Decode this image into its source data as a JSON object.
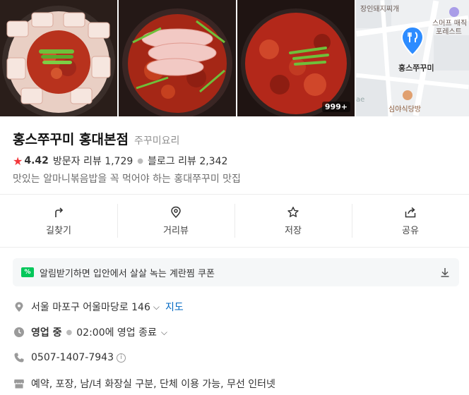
{
  "photos": {
    "count_badge": "999+"
  },
  "map": {
    "labels": {
      "top_left": "장인돼지찌개",
      "top_right_1": "스머프 매직",
      "top_right_2": "포레스트",
      "pin": "홍스쭈꾸미",
      "bottom": "심야식당방",
      "edge": "ae"
    }
  },
  "place": {
    "name": "홍스쭈꾸미 홍대본점",
    "category": "주꾸미요리",
    "rating": "4.42",
    "visitor_reviews": "방문자 리뷰 1,729",
    "blog_reviews": "블로그 리뷰 2,342",
    "description": "맛있는 알마니볶음밥을 꼭 먹어야 하는 홍대쭈꾸미 맛집"
  },
  "actions": [
    {
      "label": "길찾기"
    },
    {
      "label": "거리뷰"
    },
    {
      "label": "저장"
    },
    {
      "label": "공유"
    }
  ],
  "coupon": {
    "badge": "%",
    "text": "알림받기하면 입안에서 살살 녹는 계란찜 쿠폰"
  },
  "info": {
    "address": "서울 마포구 어울마당로 146",
    "map_link": "지도",
    "status": "영업 중",
    "hours": "02:00에 영업 종료",
    "phone": "0507-1407-7943",
    "amenities": "예약, 포장, 남/녀 화장실 구분, 단체 이용 가능, 무선 인터넷"
  },
  "colors": {
    "star": "#f3363a",
    "link": "#0068c3",
    "coupon_green": "#03c75a",
    "pin_blue": "#2d8cff"
  }
}
